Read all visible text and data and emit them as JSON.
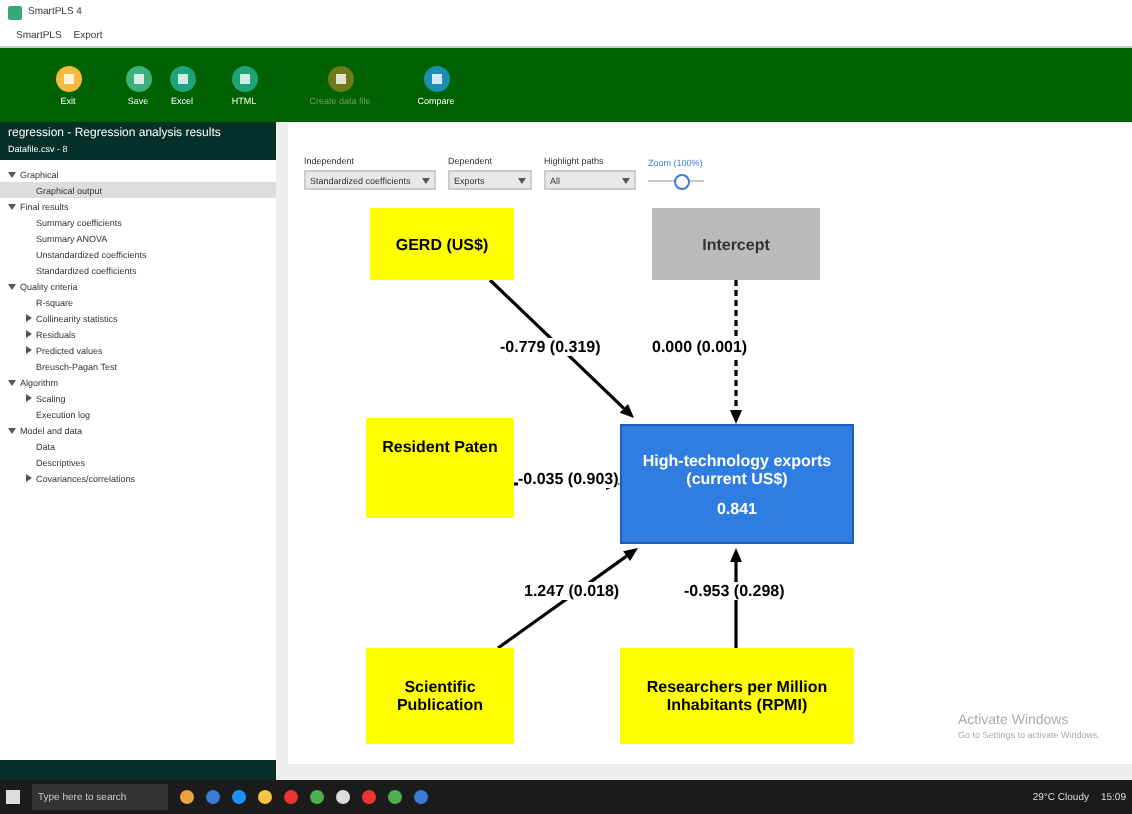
{
  "window": {
    "title": "SmartPLS 4"
  },
  "menu": [
    "SmartPLS",
    "Export"
  ],
  "toolbar": [
    {
      "label": "Exit",
      "kind": "exit",
      "disabled": false
    },
    {
      "label": "Save",
      "kind": "save",
      "disabled": false
    },
    {
      "label": "Excel",
      "kind": "excel",
      "disabled": false
    },
    {
      "label": "HTML",
      "kind": "html",
      "disabled": false
    },
    {
      "label": "Create data file",
      "kind": "data",
      "disabled": true
    },
    {
      "label": "Compare",
      "kind": "compare",
      "disabled": false
    }
  ],
  "sidebar": {
    "title": "regression - Regression analysis results",
    "subtitle": "Datafile.csv - 8",
    "items": [
      {
        "label": "Graphical",
        "expanded": true,
        "selected": false,
        "children": [
          {
            "label": "Graphical output",
            "selected": true
          }
        ]
      },
      {
        "label": "Final results",
        "expanded": true,
        "selected": false,
        "children": [
          {
            "label": "Summary coefficients",
            "selected": false
          },
          {
            "label": "Summary ANOVA",
            "selected": false
          },
          {
            "label": "Unstandardized coefficients",
            "selected": false
          },
          {
            "label": "Standardized coefficients",
            "selected": false
          }
        ]
      },
      {
        "label": "Quality criteria",
        "expanded": true,
        "selected": false,
        "children": [
          {
            "label": "R-square",
            "selected": false
          },
          {
            "label": "Collinearity statistics",
            "expanded": false,
            "selected": false
          },
          {
            "label": "Residuals",
            "expanded": false,
            "selected": false
          },
          {
            "label": "Predicted values",
            "expanded": false,
            "selected": false
          },
          {
            "label": "Breusch-Pagan Test",
            "selected": false
          }
        ]
      },
      {
        "label": "Algorithm",
        "expanded": true,
        "selected": false,
        "children": [
          {
            "label": "Scaling",
            "expanded": false,
            "selected": false
          },
          {
            "label": "Execution log",
            "selected": false
          }
        ]
      },
      {
        "label": "Model and data",
        "expanded": true,
        "selected": false,
        "children": [
          {
            "label": "Data",
            "selected": false
          },
          {
            "label": "Descriptives",
            "selected": false
          },
          {
            "label": "Covariances/correlations",
            "expanded": false,
            "selected": false
          }
        ]
      }
    ]
  },
  "controls": [
    {
      "label": "Independent",
      "value": "Standardized coefficients"
    },
    {
      "label": "Dependent",
      "value": "Exports"
    },
    {
      "label": "Highlight paths",
      "value": "All"
    }
  ],
  "zoom": {
    "label": "Zoom (100%)",
    "level": 0.6
  },
  "diagram": {
    "nodes": [
      {
        "label": "GERD (US$)",
        "kind": "predictor"
      },
      {
        "label": "Intercept",
        "kind": "intercept"
      },
      {
        "label": "Resident Paten",
        "kind": "predictor"
      },
      {
        "label": "High-technology exports (current US$)",
        "value": "0.841",
        "kind": "target"
      },
      {
        "label": "Scientific Publication",
        "kind": "predictor"
      },
      {
        "label": "Researchers per Million Inhabitants (RPMI)",
        "kind": "predictor"
      }
    ],
    "paths": [
      {
        "label": "-0.779 (0.319)",
        "kind": "solid"
      },
      {
        "label": "0.000 (0.001)",
        "kind": "dashed"
      },
      {
        "label": "-0.035 (0.903)",
        "kind": "solid"
      },
      {
        "label": "1.247 (0.018)",
        "kind": "solid"
      },
      {
        "label": "-0.953 (0.298)",
        "kind": "solid"
      }
    ]
  },
  "watermark": {
    "title": "Activate Windows",
    "text": "Go to Settings to activate Windows."
  },
  "taskbar": {
    "search": "Type here to search",
    "weather": "29°C Cloudy",
    "time": "15:09"
  }
}
